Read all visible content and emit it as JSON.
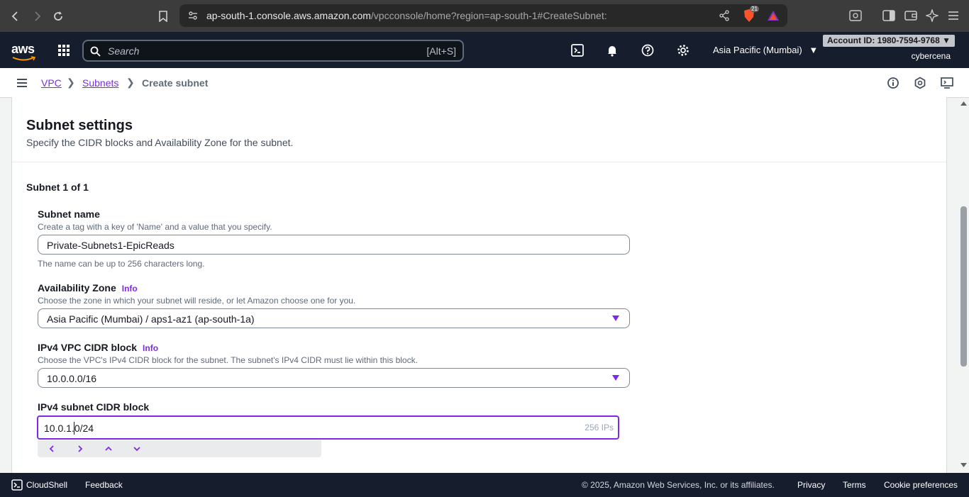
{
  "browser": {
    "url_host": "ap-south-1.console.aws.amazon.com",
    "url_path": "/vpcconsole/home?region=ap-south-1#CreateSubnet:",
    "brave_badge": "21"
  },
  "aws_nav": {
    "logo": "aws",
    "search_placeholder": "Search",
    "search_shortcut": "[Alt+S]",
    "region": "Asia Pacific (Mumbai)",
    "account_id": "Account ID: 1980-7594-9768",
    "username": "cybercena"
  },
  "breadcrumb": {
    "items": [
      "VPC",
      "Subnets"
    ],
    "current": "Create subnet"
  },
  "section": {
    "title": "Subnet settings",
    "description": "Specify the CIDR blocks and Availability Zone for the subnet.",
    "subnet_count": "Subnet 1 of 1"
  },
  "fields": {
    "subnet_name": {
      "label": "Subnet name",
      "description": "Create a tag with a key of 'Name' and a value that you specify.",
      "value": "Private-Subnets1-EpicReads",
      "constraint": "The name can be up to 256 characters long."
    },
    "az": {
      "label": "Availability Zone",
      "info": "Info",
      "description": "Choose the zone in which your subnet will reside, or let Amazon choose one for you.",
      "value": "Asia Pacific (Mumbai) / aps1-az1 (ap-south-1a)"
    },
    "vpc_cidr": {
      "label": "IPv4 VPC CIDR block",
      "info": "Info",
      "description": "Choose the VPC's IPv4 CIDR block for the subnet. The subnet's IPv4 CIDR must lie within this block.",
      "value": "10.0.0.0/16"
    },
    "subnet_cidr": {
      "label": "IPv4 subnet CIDR block",
      "value": "10.0.1.0/24",
      "ips": "256 IPs"
    }
  },
  "footer": {
    "cloudshell": "CloudShell",
    "feedback": "Feedback",
    "copyright": "© 2025, Amazon Web Services, Inc. or its affiliates.",
    "privacy": "Privacy",
    "terms": "Terms",
    "cookies": "Cookie preferences"
  },
  "colors": {
    "accent": "#7d2ae8",
    "nav_bg": "#161e2d"
  }
}
